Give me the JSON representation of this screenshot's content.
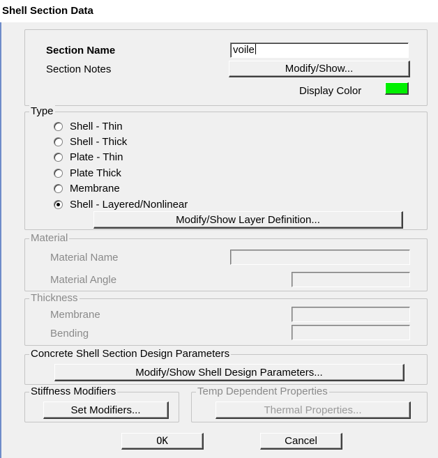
{
  "window": {
    "title": "Shell Section Data"
  },
  "section": {
    "name_label": "Section Name",
    "name_value": "voile",
    "notes_label": "Section Notes",
    "notes_button": "Modify/Show...",
    "color_label": "Display Color",
    "color": "#00f000"
  },
  "type": {
    "legend": "Type",
    "options": [
      {
        "label": "Shell - Thin",
        "checked": false
      },
      {
        "label": "Shell - Thick",
        "checked": false
      },
      {
        "label": "Plate - Thin",
        "checked": false
      },
      {
        "label": "Plate Thick",
        "checked": false
      },
      {
        "label": "Membrane",
        "checked": false
      },
      {
        "label": "Shell - Layered/Nonlinear",
        "checked": true
      }
    ],
    "layer_button": "Modify/Show Layer Definition..."
  },
  "material": {
    "legend": "Material",
    "name_label": "Material Name",
    "name_value": "",
    "angle_label": "Material Angle",
    "angle_value": ""
  },
  "thickness": {
    "legend": "Thickness",
    "membrane_label": "Membrane",
    "membrane_value": "",
    "bending_label": "Bending",
    "bending_value": ""
  },
  "concrete": {
    "legend": "Concrete Shell Section Design Parameters",
    "button": "Modify/Show Shell Design Parameters..."
  },
  "stiffness": {
    "legend": "Stiffness Modifiers",
    "button": "Set Modifiers..."
  },
  "temp": {
    "legend": "Temp Dependent Properties",
    "button": "Thermal Properties..."
  },
  "actions": {
    "ok": "OK",
    "cancel": "Cancel"
  }
}
